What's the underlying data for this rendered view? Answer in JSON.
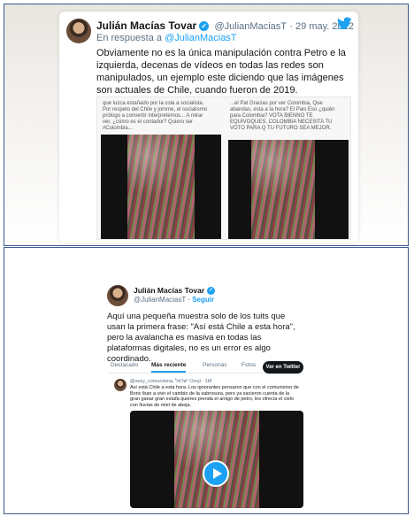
{
  "panel1": {
    "author_name": "Julián Macías Tovar",
    "author_handle": "@JulianMaciasT",
    "date": "· 29 may. 2022",
    "reply_prefix": "En respuesta a",
    "reply_handle": "@JulianMaciasT",
    "body": "Obviamente no es la única manipulación contra Petro e la izquierda, decenas de vídeos en todas las redes son manipulados, un ejemplo este diciendo que las imágenes son actuales de Chile, cuando fueron de 2019.",
    "left_media_text": "que luzca estañado por la cola a socialista. Por respeto del Chile y jomme, el socialismo prólogo a convertir interpretemos... A mirar ver, ¿cómo es el contador? Quiero ser #Colombia...",
    "right_media_text": "...el Pat Gracias por ver Colombia, Que abandas, esta a la hora? El Pais Eso ¿quién para Colombia? VOTA BIENNO TE EQUIVOQUES. COLOMBIA NECESITA TU VOTO PARA Q TU FUTURO SEA MEJOR."
  },
  "panel2": {
    "author_name": "Julián Macías Tovar",
    "author_handle": "@JulianMaciasT",
    "follow": "Seguir",
    "body": "Aquí una pequeña muestra solo de los tuits que usan la primera frase: \"Así está Chile a esta hora\", pero la avalancha es masiva en todas las plataformas digitales, no es un error es algo coordinado.",
    "tabs": [
      "Destacado",
      "Más reciente",
      "Personas",
      "Fotos"
    ],
    "view_on_twitter": "Ver en Twitter",
    "embed_author": "@sexy_comunisma, ישראל Ozuji · 1M",
    "embed_text": "Así está Chile a esta hora. Los ignorantes pensaron que con el comunismo de Boric iban a vivir el cambio de la sabrosura, pero ya sacieron cuenta de la gran ganar gran estafa quieres prenda el amigo de petro, les ofrecía el cielo con lluvias de miel de abeja."
  },
  "colors": {
    "twitter_blue": "#1da1f2",
    "border": "#3a5a8c"
  }
}
